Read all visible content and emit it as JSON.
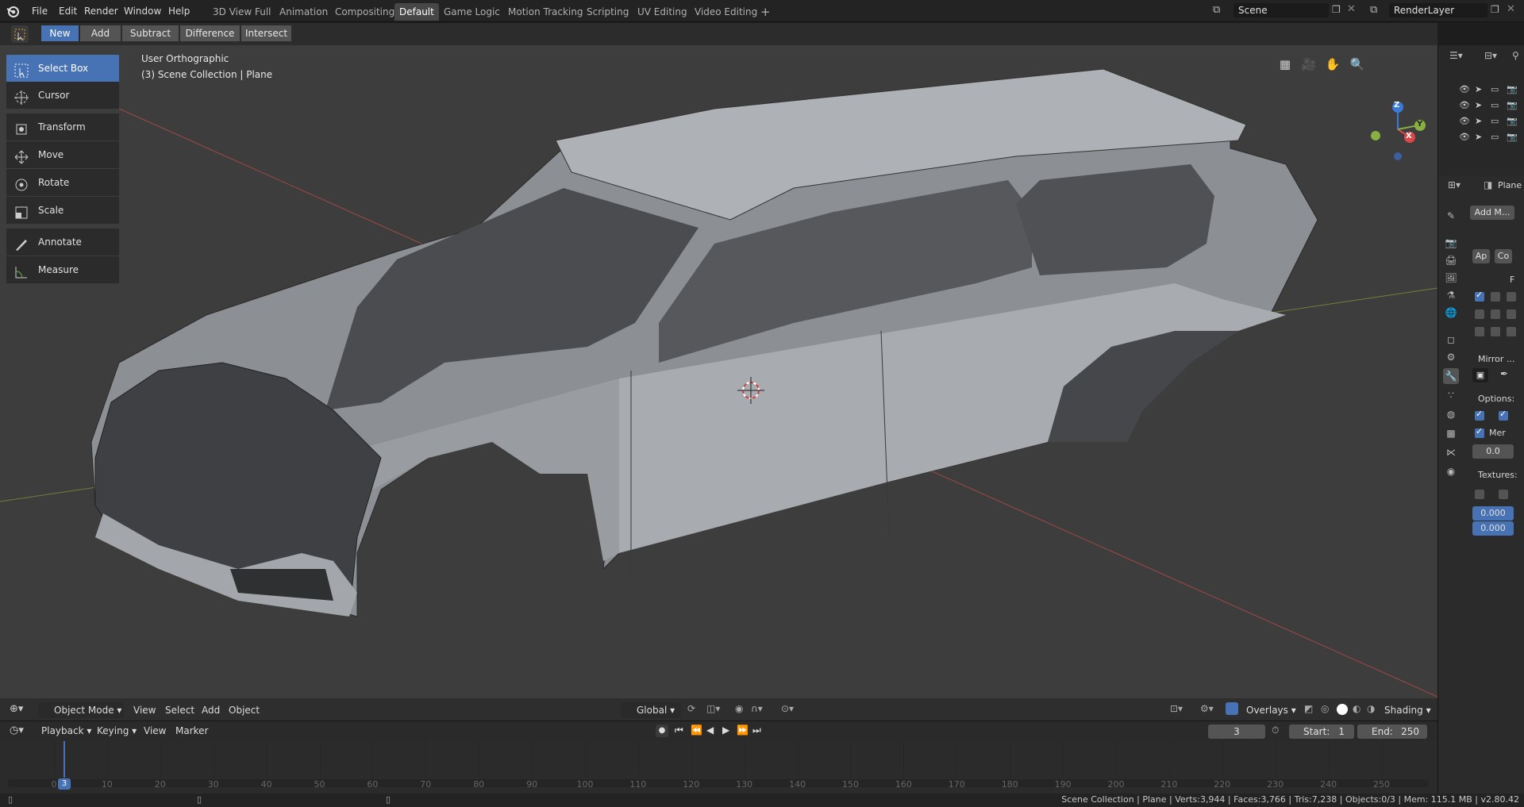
{
  "app": {
    "title": "Blender",
    "version": "v2.80.42"
  },
  "menu": [
    "File",
    "Edit",
    "Render",
    "Window",
    "Help"
  ],
  "workspaces": [
    {
      "label": "3D View Full"
    },
    {
      "label": "Animation"
    },
    {
      "label": "Compositing"
    },
    {
      "label": "Default",
      "active": true
    },
    {
      "label": "Game Logic"
    },
    {
      "label": "Motion Tracking"
    },
    {
      "label": "Scripting"
    },
    {
      "label": "UV Editing"
    },
    {
      "label": "Video Editing"
    }
  ],
  "add_workspace": "+",
  "scene": {
    "name": "Scene"
  },
  "render_layer": {
    "name": "RenderLayer"
  },
  "header": {
    "new": "New",
    "add": "Add",
    "subtract": "Subtract",
    "difference": "Difference",
    "intersect": "Intersect"
  },
  "tools": [
    {
      "label": "Select Box",
      "icon": "select-box-icon",
      "active": true
    },
    {
      "label": "Cursor",
      "icon": "cursor-icon"
    },
    {
      "label": "Transform",
      "icon": "transform-icon"
    },
    {
      "label": "Move",
      "icon": "move-icon"
    },
    {
      "label": "Rotate",
      "icon": "rotate-icon"
    },
    {
      "label": "Scale",
      "icon": "scale-icon"
    },
    {
      "label": "Annotate",
      "icon": "annotate-icon"
    },
    {
      "label": "Measure",
      "icon": "measure-icon"
    }
  ],
  "viewport": {
    "view_name": "User Orthographic",
    "collection": "(3) Scene Collection | Plane"
  },
  "gizmo": {
    "z": "Z",
    "x": "X",
    "y": "Y"
  },
  "vp_footer": {
    "mode": "Object Mode",
    "view": "View",
    "select": "Select",
    "add": "Add",
    "object": "Object",
    "orientation": "Global",
    "overlays": "Overlays",
    "shading": "Shading"
  },
  "timeline": {
    "playback": "Playback",
    "keying": "Keying",
    "view": "View",
    "marker": "Marker",
    "current_frame": "3",
    "start_label": "Start:",
    "start": "1",
    "end_label": "End:",
    "end": "250",
    "ticks": [
      "0",
      "10",
      "20",
      "30",
      "40",
      "50",
      "60",
      "70",
      "80",
      "90",
      "100",
      "110",
      "120",
      "130",
      "140",
      "150",
      "160",
      "170",
      "180",
      "190",
      "200",
      "210",
      "220",
      "230",
      "240",
      "250"
    ],
    "playhead": "3"
  },
  "status": {
    "text": "Scene Collection | Plane | Verts:3,944 | Faces:3,766 | Tris:7,238 | Objects:0/3 | Mem: 115.1 MB | v2.80.42"
  },
  "properties": {
    "object_name": "Plane",
    "add_modifier": "Add M...",
    "apply": "Ap",
    "copy": "Co",
    "f_label": "F",
    "mirror": "Mirror ...",
    "options": "Options:",
    "merge": "Mer",
    "merge_value": "0.0",
    "textures": "Textures:",
    "offset_u": "0.000",
    "offset_v": "0.000"
  },
  "colors": {
    "accent": "#4772b3",
    "viewport_bg": "#3d3d3d",
    "x_axis": "#c94a4a",
    "y_axis": "#8aa43a",
    "mesh": "#b9bcc0"
  }
}
